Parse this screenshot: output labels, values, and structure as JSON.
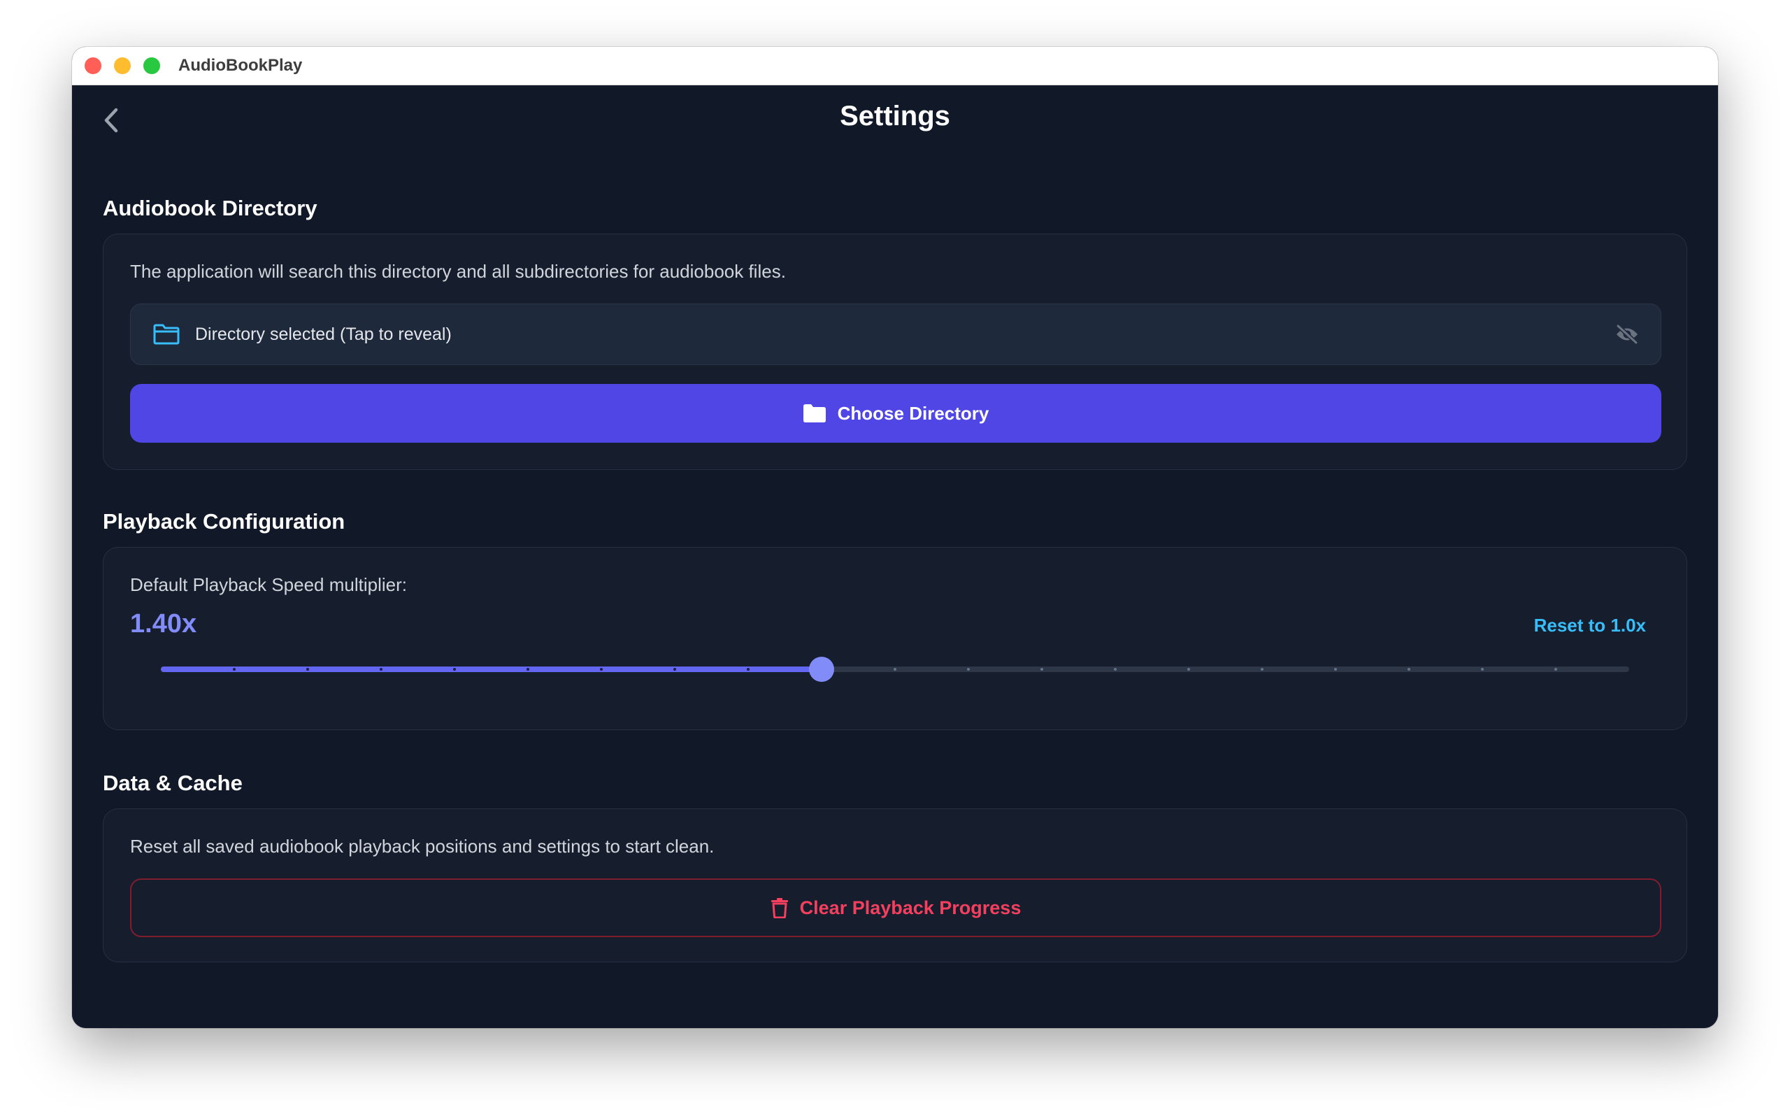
{
  "window": {
    "title": "AudioBookPlay"
  },
  "header": {
    "title": "Settings",
    "back_icon": "chevron-left-icon"
  },
  "directory": {
    "section_title": "Audiobook Directory",
    "description": "The application will search this directory and all subdirectories for audiobook files.",
    "field_text": "Directory selected (Tap to reveal)",
    "field_icon": "folder-outline-icon",
    "reveal_icon": "eye-off-icon",
    "button_label": "Choose Directory",
    "button_icon": "folder-icon"
  },
  "playback": {
    "section_title": "Playback Configuration",
    "speed_label": "Default Playback Speed multiplier:",
    "speed_value": "1.40x",
    "reset_label": "Reset to 1.0x",
    "slider": {
      "value_fraction": 0.45,
      "steps": 20
    }
  },
  "data": {
    "section_title": "Data & Cache",
    "description": "Reset all saved audiobook playback positions and settings to start clean.",
    "button_label": "Clear Playback Progress",
    "button_icon": "trash-icon"
  },
  "colors": {
    "background": "#111827",
    "card": "#161e2e",
    "accent": "#4f46e5",
    "speed": "#818cf8",
    "link": "#38bdf8",
    "danger": "#f43f5e"
  }
}
